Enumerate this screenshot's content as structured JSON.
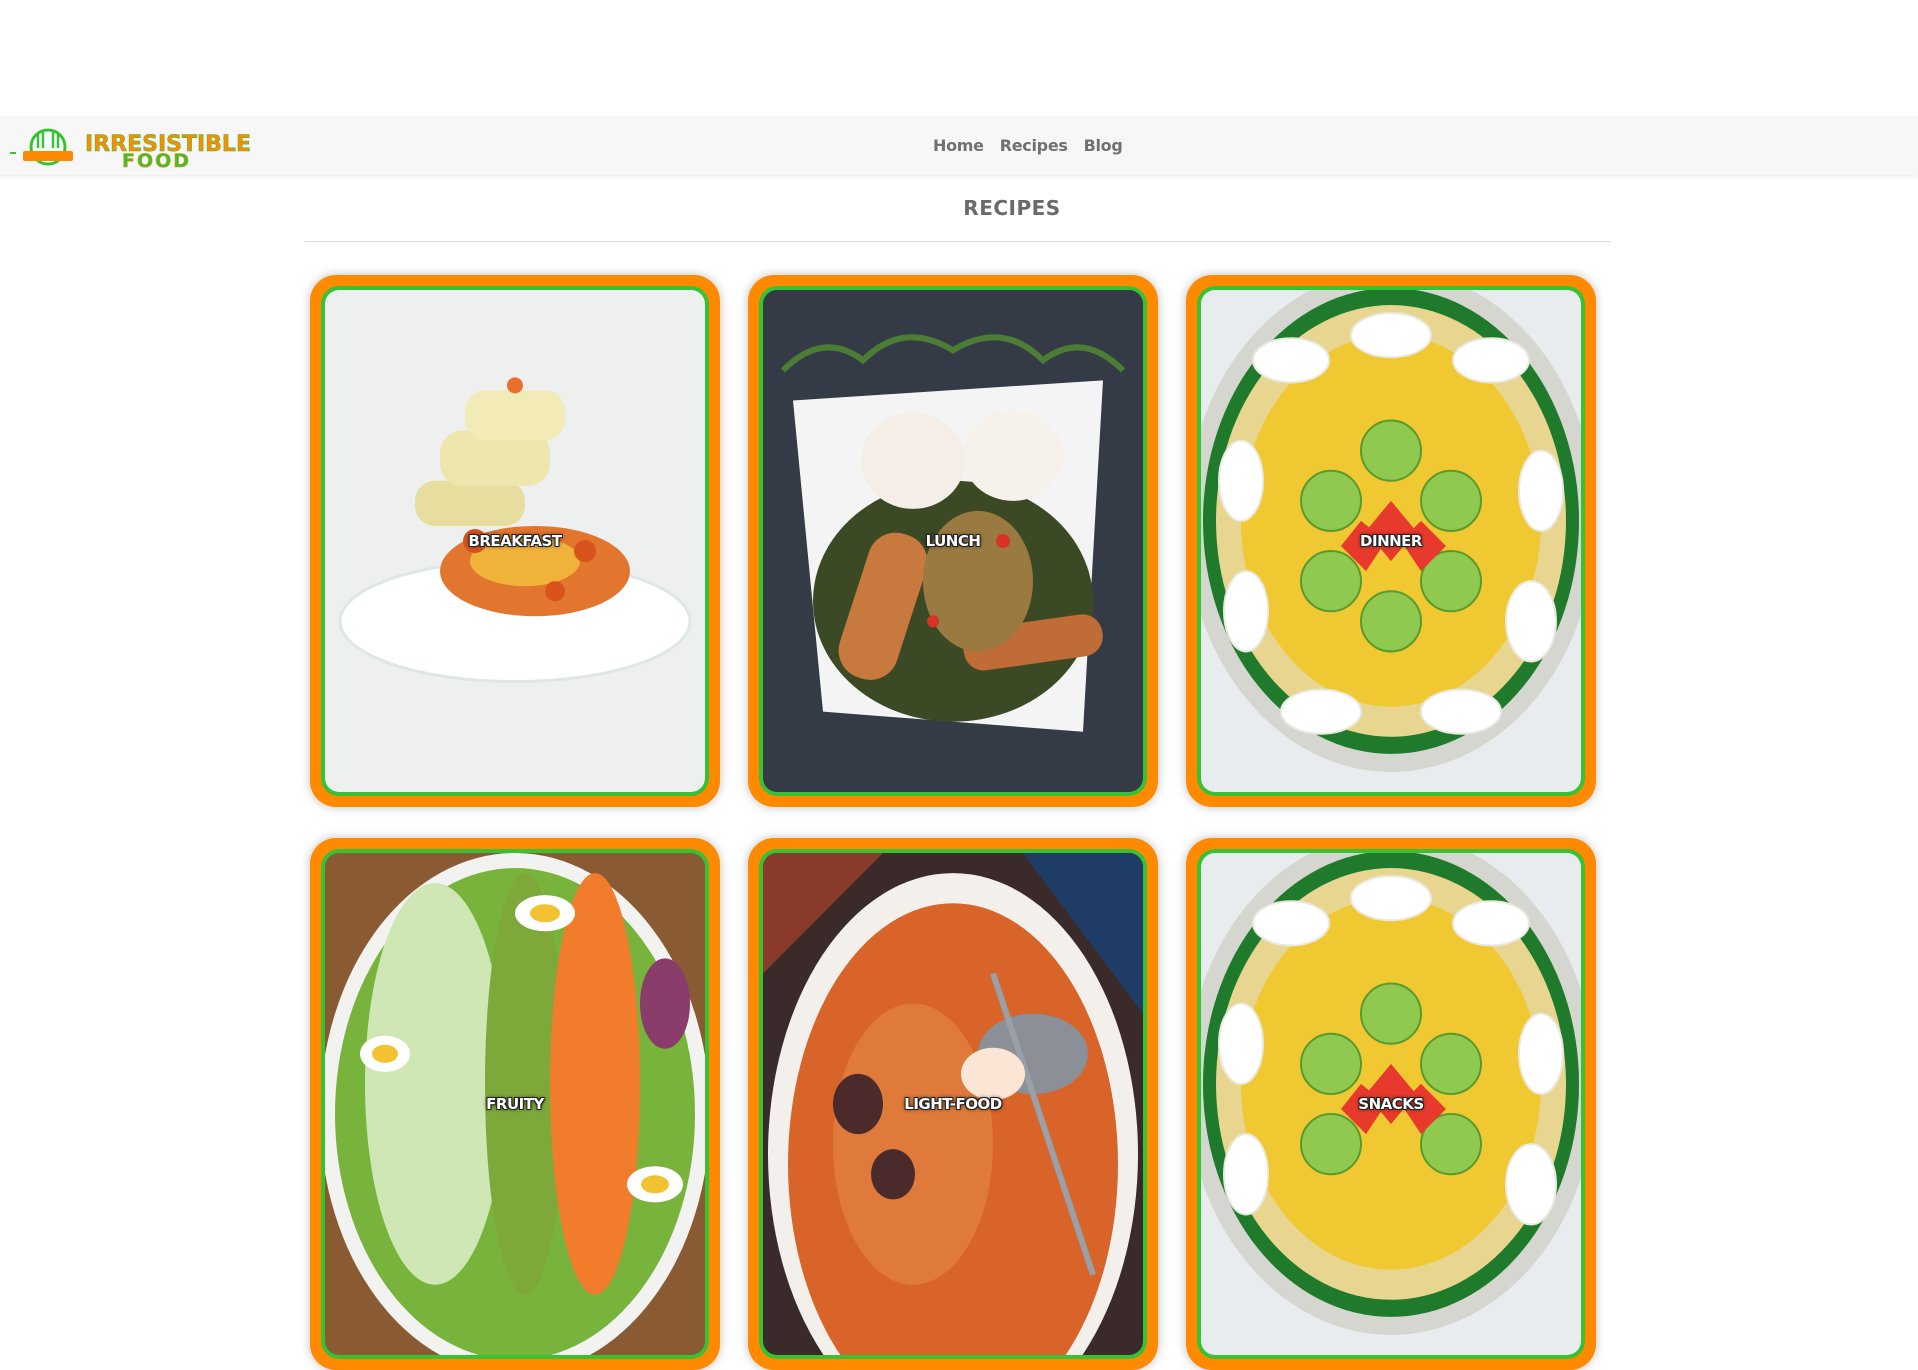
{
  "logo": {
    "line1": "IRRESISTIBLE",
    "line2": "FOOD"
  },
  "nav": {
    "items": [
      "Home",
      "Recipes",
      "Blog"
    ]
  },
  "page": {
    "title": "RECIPES"
  },
  "cards": [
    {
      "label": "BREAKFAST"
    },
    {
      "label": "LUNCH"
    },
    {
      "label": "DINNER"
    },
    {
      "label": "FRUITY"
    },
    {
      "label": "LIGHT-FOOD"
    },
    {
      "label": "SNACKS"
    }
  ],
  "colors": {
    "accent_orange": "#ff8a00",
    "accent_green": "#37c235",
    "nav_text": "#707070"
  }
}
